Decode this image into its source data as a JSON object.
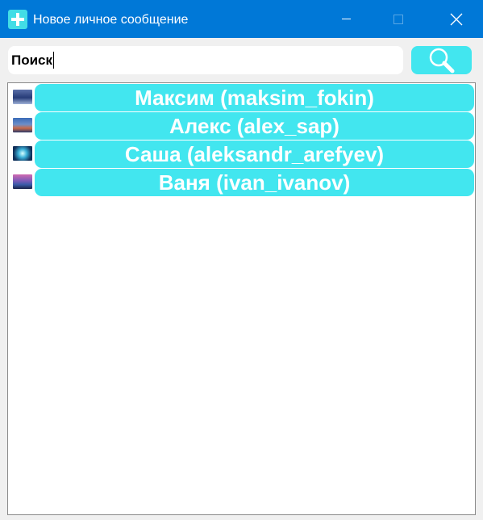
{
  "window": {
    "title": "Новое личное сообщение",
    "title_bar_color": "#0078d7",
    "controls": [
      "minimize-icon",
      "maximize-icon",
      "close-icon"
    ]
  },
  "search": {
    "value": "Поиск",
    "button_icon": "search-icon",
    "button_color": "#42e6ef"
  },
  "contacts": [
    {
      "name": "Максим (maksim_fokin)",
      "avatar": "avatar-image"
    },
    {
      "name": "Алекс (alex_sap)",
      "avatar": "avatar-image"
    },
    {
      "name": "Саша (aleksandr_arefyev)",
      "avatar": "avatar-image"
    },
    {
      "name": "Ваня (ivan_ivanov)",
      "avatar": "avatar-image"
    }
  ],
  "colors": {
    "accent": "#42e6ef",
    "list_background": "#ffffff",
    "window_background": "#f0f0f0"
  }
}
